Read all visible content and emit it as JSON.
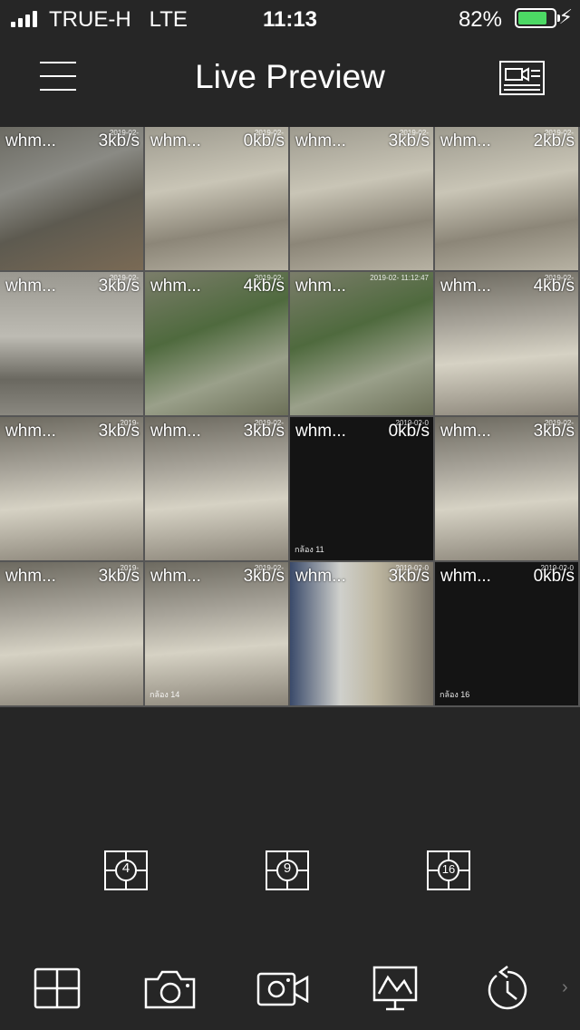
{
  "status_bar": {
    "carrier": "TRUE-H",
    "network": "LTE",
    "time": "11:13",
    "battery_percent": "82%",
    "battery_level": 0.82,
    "battery_color": "#4cd964",
    "signal_bars": 4,
    "charging_icon": "bolt-icon"
  },
  "nav": {
    "title": "Live Preview",
    "menu_icon": "menu-icon",
    "right_icon": "camera-list-icon"
  },
  "selected_channel": 2,
  "channels": [
    {
      "name": "whm...",
      "rate": "3kb/s",
      "date": "2019-02-",
      "label": "",
      "scene": "yard"
    },
    {
      "name": "whm...",
      "rate": "0kb/s",
      "date": "2019-02-",
      "label": "",
      "scene": "office"
    },
    {
      "name": "whm...",
      "rate": "3kb/s",
      "date": "2019-02-",
      "label": "",
      "scene": "office"
    },
    {
      "name": "whm...",
      "rate": "2kb/s",
      "date": "2019-02-",
      "label": "",
      "scene": "office"
    },
    {
      "name": "whm...",
      "rate": "3kb/s",
      "date": "2019-02-",
      "label": "",
      "scene": "hall"
    },
    {
      "name": "whm...",
      "rate": "4kb/s",
      "date": "2019-02-",
      "label": "",
      "scene": "garden"
    },
    {
      "name": "whm...",
      "rate": "",
      "date": "2019-02- 11:12:47",
      "label": "",
      "scene": "garden"
    },
    {
      "name": "whm...",
      "rate": "4kb/s",
      "date": "2019-02-",
      "label": "",
      "scene": "warehouse"
    },
    {
      "name": "whm...",
      "rate": "3kb/s",
      "date": "2019-",
      "label": "",
      "scene": "warehouse"
    },
    {
      "name": "whm...",
      "rate": "3kb/s",
      "date": "2019-02-",
      "label": "",
      "scene": "warehouse"
    },
    {
      "name": "whm...",
      "rate": "0kb/s",
      "date": "2019-02-0",
      "label": "กล้อง 11",
      "scene": "black"
    },
    {
      "name": "whm...",
      "rate": "3kb/s",
      "date": "2019-02-",
      "label": "",
      "scene": "warehouse"
    },
    {
      "name": "whm...",
      "rate": "3kb/s",
      "date": "2019-",
      "label": "",
      "scene": "warehouse"
    },
    {
      "name": "whm...",
      "rate": "3kb/s",
      "date": "2019-02-",
      "label": "กล้อง 14",
      "scene": "warehouse"
    },
    {
      "name": "whm...",
      "rate": "3kb/s",
      "date": "2019-02-0",
      "label": "",
      "scene": "corridor"
    },
    {
      "name": "whm...",
      "rate": "0kb/s",
      "date": "2019-02-0",
      "label": "กล้อง 16",
      "scene": "black"
    }
  ],
  "split_options": [
    {
      "label": "4",
      "icon": "split-4-icon"
    },
    {
      "label": "9",
      "icon": "split-9-icon"
    },
    {
      "label": "16",
      "icon": "split-16-icon"
    }
  ],
  "toolbar": [
    {
      "icon": "grid-icon"
    },
    {
      "icon": "snapshot-camera-icon"
    },
    {
      "icon": "record-video-icon"
    },
    {
      "icon": "display-chart-icon"
    },
    {
      "icon": "playback-clock-icon"
    }
  ],
  "toolbar_more_glyph": "›"
}
